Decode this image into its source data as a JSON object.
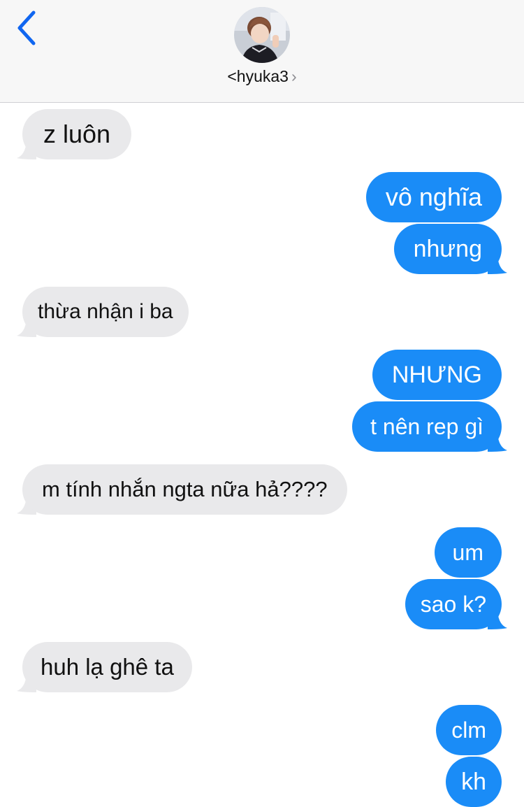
{
  "contact": {
    "name": "hyuka3",
    "prefix": "<",
    "chevron": "›"
  },
  "colors": {
    "incoming_bubble": "#e9e9eb",
    "outgoing_bubble": "#1a8cf7",
    "accent": "#1066f0"
  },
  "icons": {
    "back": "back-chevron-icon",
    "avatar": "contact-avatar"
  },
  "messages": [
    {
      "from": "them",
      "text": "z luôn"
    },
    {
      "from": "me",
      "text": "vô nghĩa"
    },
    {
      "from": "me",
      "text": "nhưng"
    },
    {
      "from": "them",
      "text": "thừa nhận i ba"
    },
    {
      "from": "me",
      "text": "NHƯNG"
    },
    {
      "from": "me",
      "text": "t nên rep gì"
    },
    {
      "from": "them",
      "text": "m tính nhắn ngta nữa hả????"
    },
    {
      "from": "me",
      "text": "um"
    },
    {
      "from": "me",
      "text": "sao k?"
    },
    {
      "from": "them",
      "text": "huh lạ ghê ta"
    },
    {
      "from": "me",
      "text": "clm"
    },
    {
      "from": "me",
      "text": "kh"
    }
  ]
}
